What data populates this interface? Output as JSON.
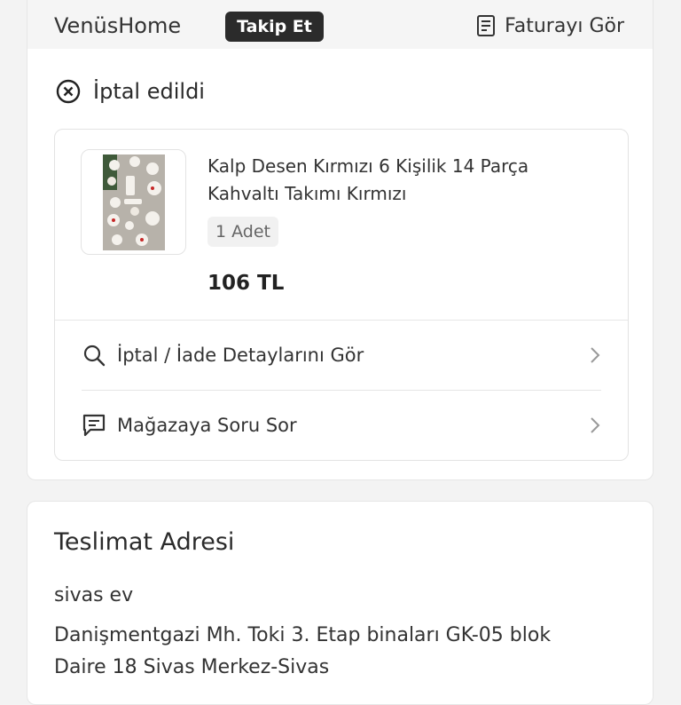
{
  "store": {
    "name": "VenüsHome",
    "follow_label": "Takip Et",
    "invoice_label": "Faturayı Gör"
  },
  "order": {
    "status": "İptal edildi",
    "product": {
      "title": "Kalp Desen Kırmızı 6 Kişilik 14 Parça Kahvaltı Takımı Kırmızı",
      "quantity": "1 Adet",
      "price": "106 TL"
    },
    "actions": [
      {
        "label": "İptal / İade Detaylarını Gör",
        "icon": "search-icon"
      },
      {
        "label": "Mağazaya Soru Sor",
        "icon": "message-icon"
      }
    ]
  },
  "delivery": {
    "title": "Teslimat Adresi",
    "name": "sivas ev",
    "address_line1": "Danişmentgazi Mh.  Toki 3. Etap binaları GK-05 blok",
    "address_line2": "Daire 18 Sivas Merkez-Sivas"
  },
  "colors": {
    "follow_bg": "#2b2b2b",
    "header_bg": "#f5f5f5",
    "page_bg": "#f3f3f3"
  }
}
